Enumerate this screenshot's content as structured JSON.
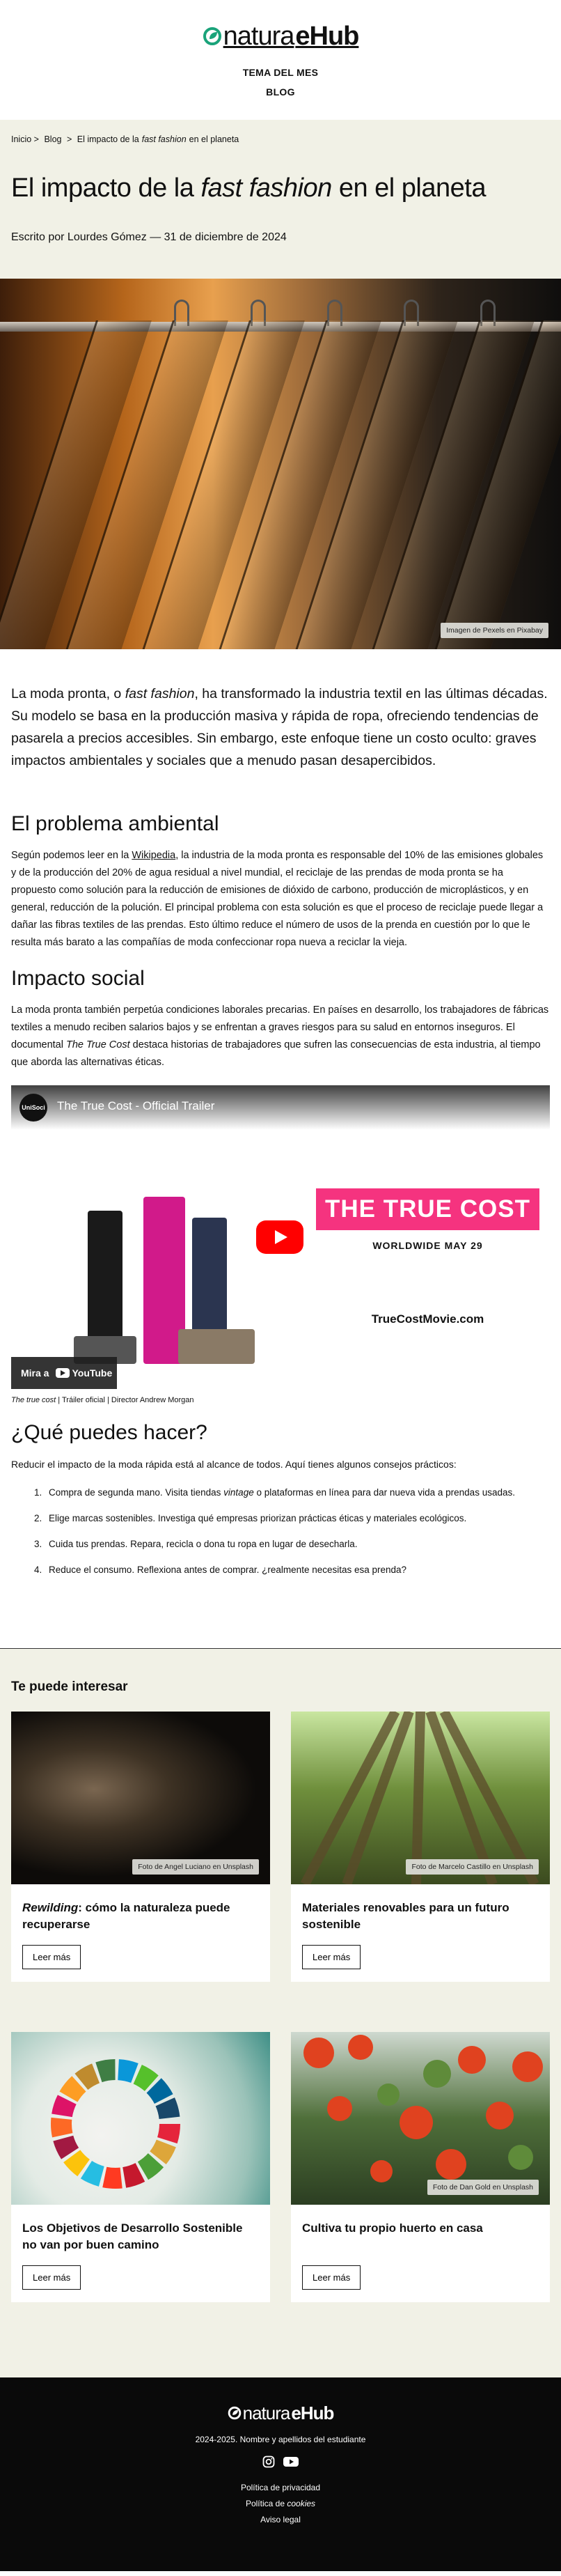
{
  "brand": {
    "part1": "natura",
    "part2": "eHub",
    "accent": "#1aa37a"
  },
  "nav": {
    "items": [
      {
        "label": "TEMA DEL MES"
      },
      {
        "label": "BLOG"
      }
    ]
  },
  "breadcrumb": {
    "home": "Inicio",
    "sep": ">",
    "blog": "Blog",
    "current_prefix": "El impacto de la",
    "current_em": "fast fashion",
    "current_suffix": "en el planeta"
  },
  "article": {
    "title_prefix": "El impacto de la",
    "title_em": "fast fashion",
    "title_suffix": "en el planeta",
    "byline": "Escrito por Lourdes Gómez — 31 de diciembre de 2024",
    "hero_credit": "Imagen de Pexels en Pixabay",
    "lead_1": "La moda pronta, o",
    "lead_em": "fast fashion",
    "lead_2": ", ha transformado la industria textil en las últimas décadas. Su modelo se basa en la producción masiva y rápida de ropa, ofreciendo tendencias de pasarela a precios accesibles. Sin embargo, este enfoque tiene un costo oculto: graves impactos ambientales y sociales que a menudo pasan desapercibidos.",
    "section1": {
      "title": "El problema ambiental",
      "p_1": "Según podemos leer en la",
      "link": "Wikipedia",
      "p_2": ", la industria de la moda pronta es responsable del 10% de las emisiones globales y de la producción del 20% de agua residual a nivel mundial, el reciclaje de las prendas de moda pronta se ha propuesto como solución para la reducción de emisiones de dióxido de carbono, producción de microplásticos, y en general, reducción de la polución. El principal problema con esta solución es que el proceso de reciclaje puede llegar a dañar las fibras textiles de las prendas. Esto último reduce el número de usos de la prenda en cuestión por lo que le resulta más barato a las compañías de moda confeccionar ropa nueva a reciclar la vieja."
    },
    "section2": {
      "title": "Impacto social",
      "p_1": "La moda pronta también perpetúa condiciones laborales precarias. En países en desarrollo, los trabajadores de fábricas textiles a menudo reciben salarios bajos y se enfrentan a graves riesgos para su salud en entornos inseguros. El documental",
      "p_em": "The True Cost",
      "p_2": "destaca historias de trabajadores que sufren las consecuencias de esta industria, al tiempo que aborda las alternativas éticas."
    },
    "video": {
      "channel": "UniSoci",
      "title": "The True Cost - Official Trailer",
      "headline": "THE TRUE COST",
      "date": "WORLDWIDE MAY 29",
      "site": "TrueCostMovie.com",
      "watch_on": "Mira a",
      "youtube": "YouTube",
      "accent": "#f5337f",
      "caption_em": "The true cost",
      "caption_rest": " | Tráiler oficial | Director Andrew Morgan"
    },
    "section3": {
      "title": "¿Qué puedes hacer?",
      "intro": "Reducir el impacto de la moda rápida está al alcance de todos. Aquí tienes algunos consejos prácticos:",
      "tips": [
        {
          "pre": "Compra de segunda mano. Visita tiendas",
          "em": "vintage",
          "post": "o plataformas en línea para dar nueva vida a prendas usadas."
        },
        {
          "pre": "Elige marcas sostenibles. Investiga qué empresas priorizan prácticas éticas y materiales ecológicos.",
          "em": "",
          "post": ""
        },
        {
          "pre": "Cuida tus prendas. Repara, recicla o dona tu ropa en lugar de desecharla.",
          "em": "",
          "post": ""
        },
        {
          "pre": "Reduce el consumo. Reflexiona antes de comprar. ¿realmente necesitas esa prenda?",
          "em": "",
          "post": ""
        }
      ]
    }
  },
  "related": {
    "heading": "Te puede interesar",
    "cards": [
      {
        "title_em": "Rewilding",
        "title_rest": ": cómo la naturaleza puede recuperarse",
        "credit": "Foto de Angel Luciano en Unsplash",
        "button": "Leer más",
        "image": "bear"
      },
      {
        "title_em": "",
        "title_rest": "Materiales renovables para un futuro sostenible",
        "credit": "Foto de Marcelo Castillo en Unsplash",
        "button": "Leer más",
        "image": "bamboo"
      },
      {
        "title_em": "",
        "title_rest": "Los Objetivos de Desarrollo Sostenible no van por buen camino",
        "credit": "",
        "button": "Leer más",
        "image": "sdg-wheel"
      },
      {
        "title_em": "",
        "title_rest": "Cultiva tu propio huerto en casa",
        "credit": "Foto de Dan Gold en Unsplash",
        "button": "Leer más",
        "image": "tomatoes"
      }
    ]
  },
  "footer": {
    "copyright": "2024-2025. Nombre y apellidos del estudiante",
    "social": [
      {
        "icon": "instagram-icon"
      },
      {
        "icon": "youtube-icon"
      }
    ],
    "links": [
      {
        "pre": "Política de privacidad",
        "em": "",
        "post": ""
      },
      {
        "pre": "Política de",
        "em": "cookies",
        "post": ""
      },
      {
        "pre": "Aviso legal",
        "em": "",
        "post": ""
      }
    ]
  }
}
